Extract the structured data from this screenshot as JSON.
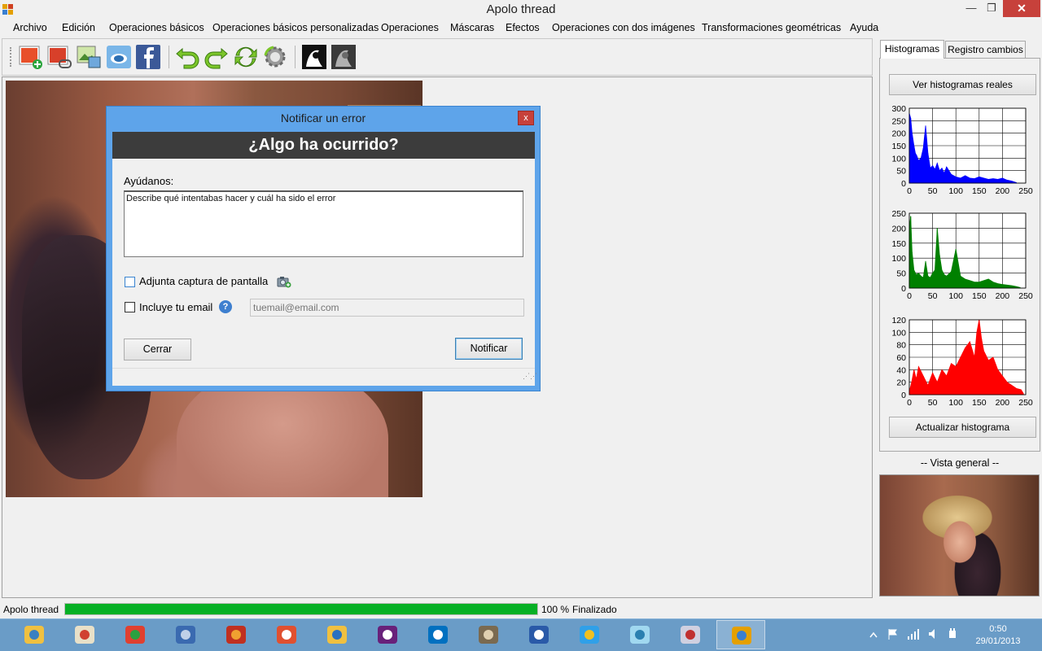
{
  "window": {
    "title": "Apolo thread",
    "minimize_label": "—",
    "maximize_label": "❐",
    "close_label": "✕"
  },
  "menu": [
    "Archivo",
    "Edición",
    "Operaciones básicos",
    "Operaciones básicos personalizadas",
    "Operaciones",
    "Máscaras",
    "Efectos",
    "Operaciones con dos imágenes",
    "Transformaciones geométricas",
    "Ayuda"
  ],
  "toolbar": {
    "icons": [
      "new-image-icon",
      "open-image-icon",
      "add-image-icon",
      "flickr-icon",
      "facebook-icon",
      "undo-icon",
      "redo-icon",
      "refresh-icon",
      "settings-gear-icon",
      "bw-image-icon",
      "grayscale-image-icon"
    ]
  },
  "dialog": {
    "title": "Notificar un error",
    "close_label": "x",
    "header": "¿Algo ha ocurrido?",
    "help_label": "Ayúdanos:",
    "description_text": "Describe qué intentabas hacer y cuál ha sido el error",
    "screenshot_label": "Adjunta captura de pantalla",
    "screenshot_checked": false,
    "email_label": "Incluye tu email",
    "email_checked": false,
    "help_icon": "?",
    "email_placeholder": "tuemail@email.com",
    "cancel_button": "Cerrar",
    "submit_button": "Notificar"
  },
  "right_panel": {
    "tabs": [
      "Histogramas",
      "Registro cambios"
    ],
    "active_tab": "Histogramas",
    "real_hist_button": "Ver histogramas reales",
    "update_button": "Actualizar histograma",
    "overview_label": "-- Vista general --"
  },
  "chart_data": [
    {
      "type": "area",
      "series": [
        {
          "color": "#0000ff",
          "x": [
            0,
            3,
            6,
            10,
            13,
            16,
            20,
            25,
            30,
            35,
            40,
            45,
            50,
            55,
            60,
            65,
            70,
            75,
            80,
            90,
            100,
            110,
            120,
            130,
            140,
            150,
            160,
            170,
            180,
            190,
            200,
            210,
            220,
            230
          ],
          "values": [
            280,
            260,
            200,
            150,
            120,
            110,
            90,
            100,
            140,
            230,
            120,
            60,
            70,
            55,
            80,
            50,
            60,
            40,
            65,
            35,
            25,
            20,
            30,
            20,
            18,
            25,
            20,
            15,
            18,
            15,
            20,
            12,
            8,
            2
          ]
        }
      ],
      "xlim": [
        0,
        250
      ],
      "ylim": [
        0,
        300
      ],
      "xticks": [
        "0",
        "50",
        "100",
        "150",
        "200",
        "250"
      ],
      "yticks": [
        "0",
        "50",
        "100",
        "150",
        "200",
        "250",
        "300"
      ],
      "grid": true
    },
    {
      "type": "area",
      "series": [
        {
          "color": "#008000",
          "x": [
            0,
            3,
            6,
            10,
            15,
            20,
            25,
            30,
            35,
            40,
            45,
            50,
            55,
            60,
            65,
            70,
            75,
            80,
            90,
            100,
            110,
            120,
            130,
            140,
            150,
            160,
            170,
            180,
            190,
            200,
            210,
            220,
            230,
            238
          ],
          "values": [
            200,
            240,
            120,
            60,
            45,
            50,
            40,
            35,
            90,
            40,
            35,
            50,
            60,
            200,
            110,
            60,
            45,
            40,
            55,
            130,
            40,
            30,
            25,
            20,
            20,
            25,
            30,
            20,
            15,
            12,
            10,
            8,
            5,
            2
          ]
        }
      ],
      "xlim": [
        0,
        250
      ],
      "ylim": [
        0,
        250
      ],
      "xticks": [
        "0",
        "50",
        "100",
        "150",
        "200",
        "250"
      ],
      "yticks": [
        "0",
        "50",
        "100",
        "150",
        "200",
        "250"
      ],
      "grid": true
    },
    {
      "type": "area",
      "series": [
        {
          "color": "#ff0000",
          "x": [
            0,
            5,
            10,
            15,
            20,
            30,
            40,
            50,
            60,
            70,
            80,
            90,
            100,
            110,
            120,
            130,
            140,
            145,
            150,
            155,
            160,
            170,
            180,
            190,
            200,
            210,
            220,
            230,
            240,
            245
          ],
          "values": [
            5,
            20,
            40,
            25,
            45,
            30,
            15,
            35,
            20,
            40,
            30,
            50,
            45,
            60,
            75,
            85,
            60,
            100,
            120,
            90,
            70,
            55,
            60,
            40,
            30,
            20,
            15,
            10,
            8,
            2
          ]
        }
      ],
      "xlim": [
        0,
        250
      ],
      "ylim": [
        0,
        120
      ],
      "xticks": [
        "0",
        "50",
        "100",
        "150",
        "200",
        "250"
      ],
      "yticks": [
        "0",
        "20",
        "40",
        "60",
        "80",
        "100",
        "120"
      ],
      "grid": true
    }
  ],
  "status": {
    "app_label": "Apolo thread",
    "progress": 1.0,
    "percent": "100 %",
    "state": "Finalizado"
  },
  "taskbar": {
    "apps": [
      "explorer-icon",
      "paint-icon",
      "chrome-icon",
      "thunderbird-icon",
      "filezilla-icon",
      "git-icon",
      "files-folder-icon",
      "visual-studio-icon",
      "vs-code-icon",
      "gimp-icon",
      "word-icon",
      "internet-explorer-icon",
      "notepad-icon",
      "sniper-icon",
      "apolo-thread-icon"
    ],
    "active_index": 14,
    "time": "0:50",
    "date": "29/01/2013"
  }
}
